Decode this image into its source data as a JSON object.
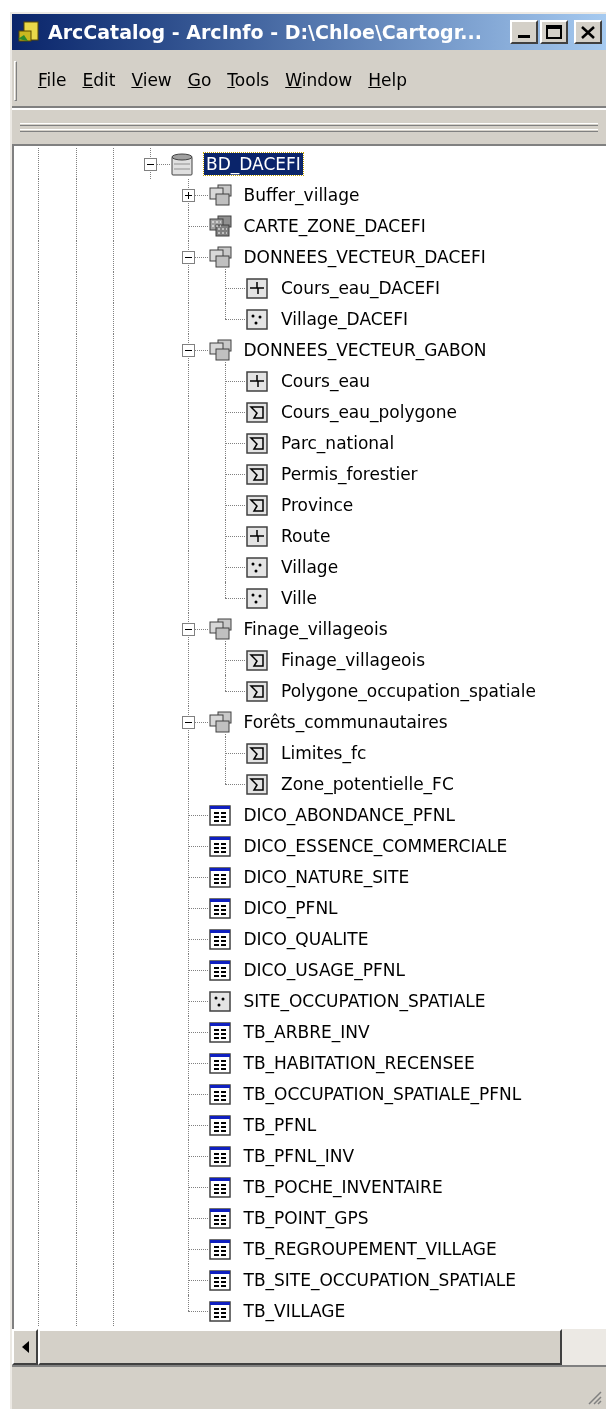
{
  "window": {
    "title": "ArcCatalog - ArcInfo - D:\\Chloe\\Cartogr..."
  },
  "menu": [
    "File",
    "Edit",
    "View",
    "Go",
    "Tools",
    "Window",
    "Help"
  ],
  "tree": [
    {
      "label": "BD_DACEFI",
      "kind": "database",
      "expanded": true,
      "selected": true,
      "children": [
        {
          "label": "Buffer_village",
          "kind": "dataset",
          "expanded": false,
          "selected": false
        },
        {
          "label": "CARTE_ZONE_DACEFI",
          "kind": "raster",
          "selected": false
        },
        {
          "label": "DONNEES_VECTEUR_DACEFI",
          "kind": "dataset",
          "expanded": true,
          "selected": false,
          "children": [
            {
              "label": "Cours_eau_DACEFI",
              "kind": "line",
              "selected": false
            },
            {
              "label": "Village_DACEFI",
              "kind": "point",
              "selected": false
            }
          ]
        },
        {
          "label": "DONNEES_VECTEUR_GABON",
          "kind": "dataset",
          "expanded": true,
          "selected": false,
          "children": [
            {
              "label": "Cours_eau",
              "kind": "line",
              "selected": false
            },
            {
              "label": "Cours_eau_polygone",
              "kind": "polygon",
              "selected": false
            },
            {
              "label": "Parc_national",
              "kind": "polygon",
              "selected": false
            },
            {
              "label": "Permis_forestier",
              "kind": "polygon",
              "selected": false
            },
            {
              "label": "Province",
              "kind": "polygon",
              "selected": false
            },
            {
              "label": "Route",
              "kind": "line",
              "selected": false
            },
            {
              "label": "Village",
              "kind": "point",
              "selected": false
            },
            {
              "label": "Ville",
              "kind": "point",
              "selected": false
            }
          ]
        },
        {
          "label": "Finage_villageois",
          "kind": "dataset",
          "expanded": true,
          "selected": false,
          "children": [
            {
              "label": "Finage_villageois",
              "kind": "polygon",
              "selected": false
            },
            {
              "label": "Polygone_occupation_spatiale",
              "kind": "polygon",
              "selected": false
            }
          ]
        },
        {
          "label": "Forêts_communautaires",
          "kind": "dataset",
          "expanded": true,
          "selected": false,
          "children": [
            {
              "label": "Limites_fc",
              "kind": "polygon",
              "selected": false
            },
            {
              "label": "Zone_potentielle_FC",
              "kind": "polygon",
              "selected": false
            }
          ]
        },
        {
          "label": "DICO_ABONDANCE_PFNL",
          "kind": "table",
          "selected": false
        },
        {
          "label": "DICO_ESSENCE_COMMERCIALE",
          "kind": "table",
          "selected": false
        },
        {
          "label": "DICO_NATURE_SITE",
          "kind": "table",
          "selected": false
        },
        {
          "label": "DICO_PFNL",
          "kind": "table",
          "selected": false
        },
        {
          "label": "DICO_QUALITE",
          "kind": "table",
          "selected": false
        },
        {
          "label": "DICO_USAGE_PFNL",
          "kind": "table",
          "selected": false
        },
        {
          "label": "SITE_OCCUPATION_SPATIALE",
          "kind": "point",
          "selected": false
        },
        {
          "label": "TB_ARBRE_INV",
          "kind": "table",
          "selected": false
        },
        {
          "label": "TB_HABITATION_RECENSEE",
          "kind": "table",
          "selected": false
        },
        {
          "label": "TB_OCCUPATION_SPATIALE_PFNL",
          "kind": "table",
          "selected": false
        },
        {
          "label": "TB_PFNL",
          "kind": "table",
          "selected": false
        },
        {
          "label": "TB_PFNL_INV",
          "kind": "table",
          "selected": false
        },
        {
          "label": "TB_POCHE_INVENTAIRE",
          "kind": "table",
          "selected": false
        },
        {
          "label": "TB_POINT_GPS",
          "kind": "table",
          "selected": false
        },
        {
          "label": "TB_REGROUPEMENT_VILLAGE",
          "kind": "table",
          "selected": false
        },
        {
          "label": "TB_SITE_OCCUPATION_SPATIALE",
          "kind": "table",
          "selected": false
        },
        {
          "label": "TB_VILLAGE",
          "kind": "table",
          "selected": false
        }
      ]
    }
  ]
}
